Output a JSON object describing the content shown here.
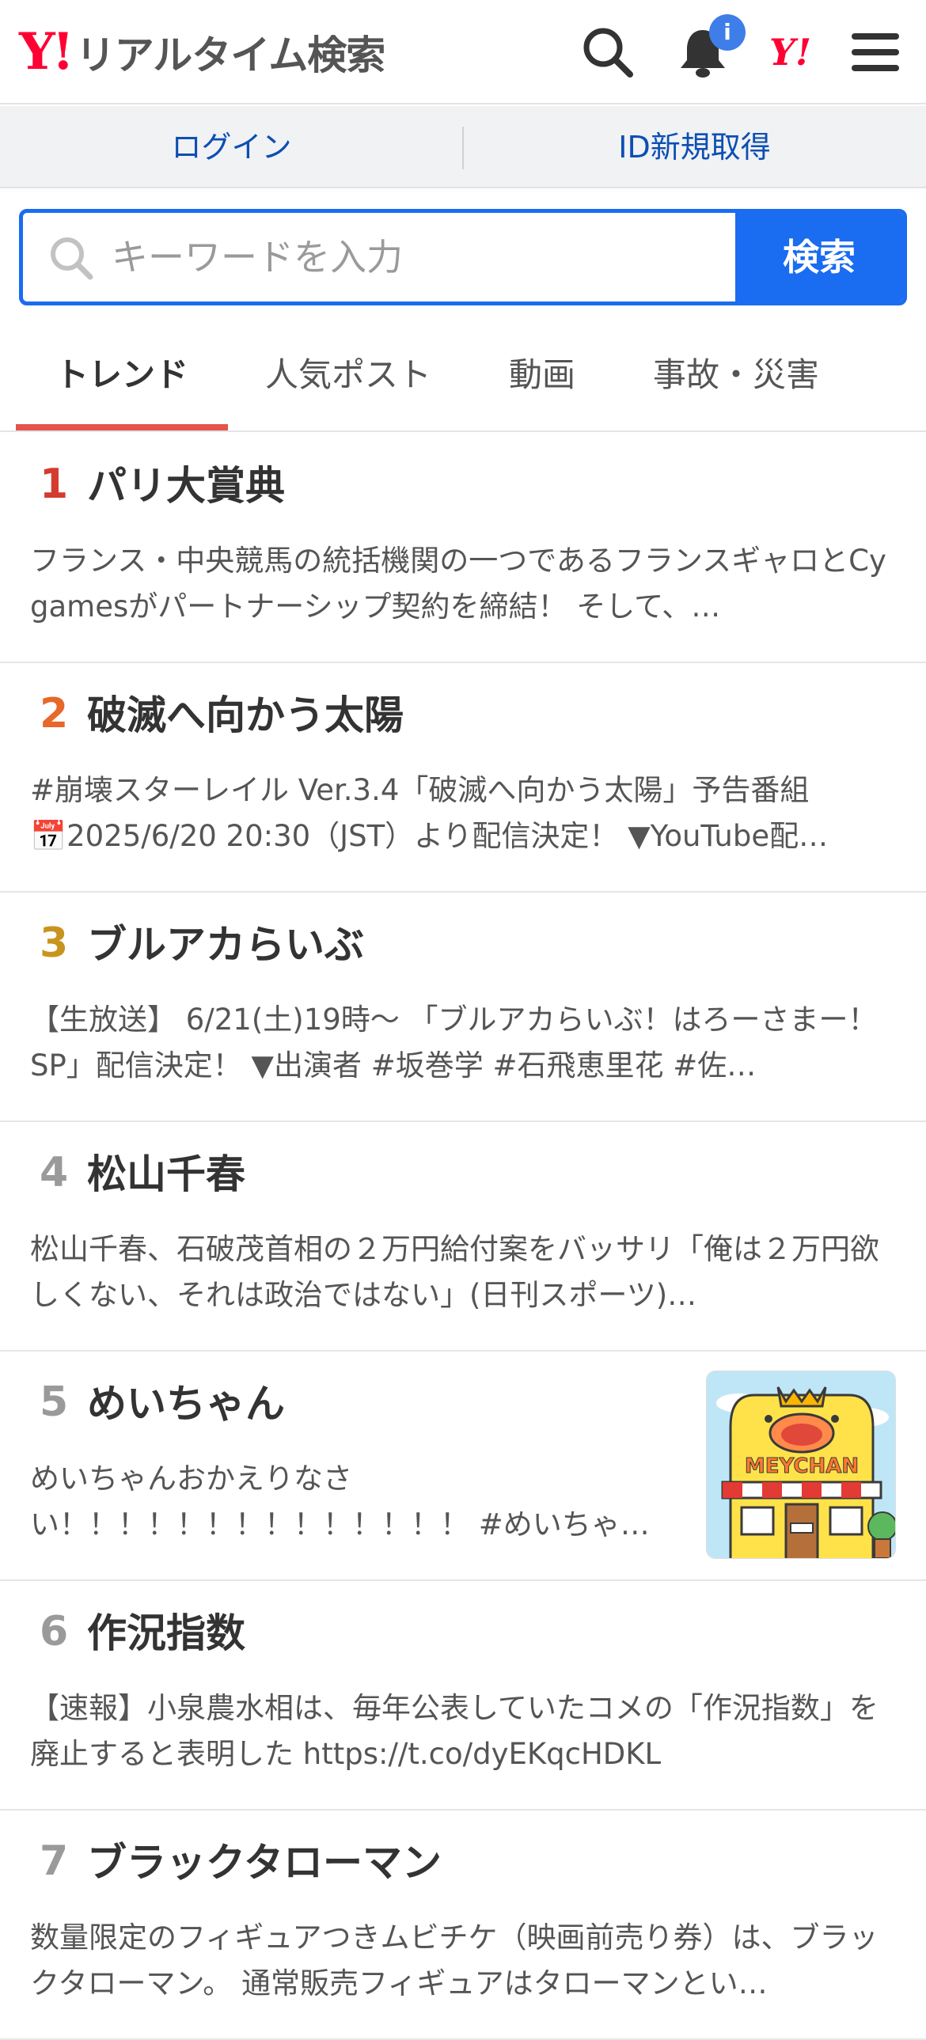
{
  "header": {
    "logo_mark": "Y!",
    "title": "リアルタイム検索",
    "notification_badge": "i",
    "yj_mark": "Y!"
  },
  "login_bar": {
    "login": "ログイン",
    "signup": "ID新規取得"
  },
  "search": {
    "placeholder": "キーワードを入力",
    "button": "検索"
  },
  "tabs": [
    {
      "label": "トレンド",
      "active": true
    },
    {
      "label": "人気ポスト",
      "active": false
    },
    {
      "label": "動画",
      "active": false
    },
    {
      "label": "事故・災害",
      "active": false
    }
  ],
  "colors": {
    "accent_blue": "#1a6cf0",
    "tab_underline": "#e4544a",
    "rank_1": "#d43b2f",
    "rank_2": "#e8672a",
    "rank_3": "#c9941e",
    "rank_other": "#9a9a9a"
  },
  "trends": [
    {
      "rank": "1",
      "title": "パリ大賞典",
      "desc": "フランス・中央競馬の統括機関の一つであるフランスギャロとCygamesがパートナーシップ契約を締結！ そして、…"
    },
    {
      "rank": "2",
      "title": "破滅へ向かう太陽",
      "desc": "#崩壊スターレイル Ver.3.4「破滅へ向かう太陽」予告番組\n📅2025/6/20 20:30（JST）より配信決定！ ▼YouTube配…"
    },
    {
      "rank": "3",
      "title": "ブルアカらいぶ",
      "desc": "【生放送】 6/21(土)19時〜 「ブルアカらいぶ！はろーさまー！SP」配信決定！ ▼出演者 #坂巻学 #石飛恵里花 #佐…"
    },
    {
      "rank": "4",
      "title": "松山千春",
      "desc": "松山千春、石破茂首相の２万円給付案をバッサリ「俺は２万円欲しくない、それは政治ではない」(日刊スポーツ)…"
    },
    {
      "rank": "5",
      "title": "めいちゃん",
      "desc": "めいちゃんおかえりなさい！！！！！！！！！！！！！！ #めいちゃ…",
      "thumbnail_text": "MEYCHAN"
    },
    {
      "rank": "6",
      "title": "作況指数",
      "desc": "【速報】小泉農水相は、毎年公表していたコメの「作況指数」を廃止すると表明した https://t.co/dyEKqcHDKL"
    },
    {
      "rank": "7",
      "title": "ブラックタローマン",
      "desc": "数量限定のフィギュアつきムビチケ（映画前売り券）は、ブラックタローマン。 通常販売フィギュアはタローマンとい…"
    }
  ]
}
